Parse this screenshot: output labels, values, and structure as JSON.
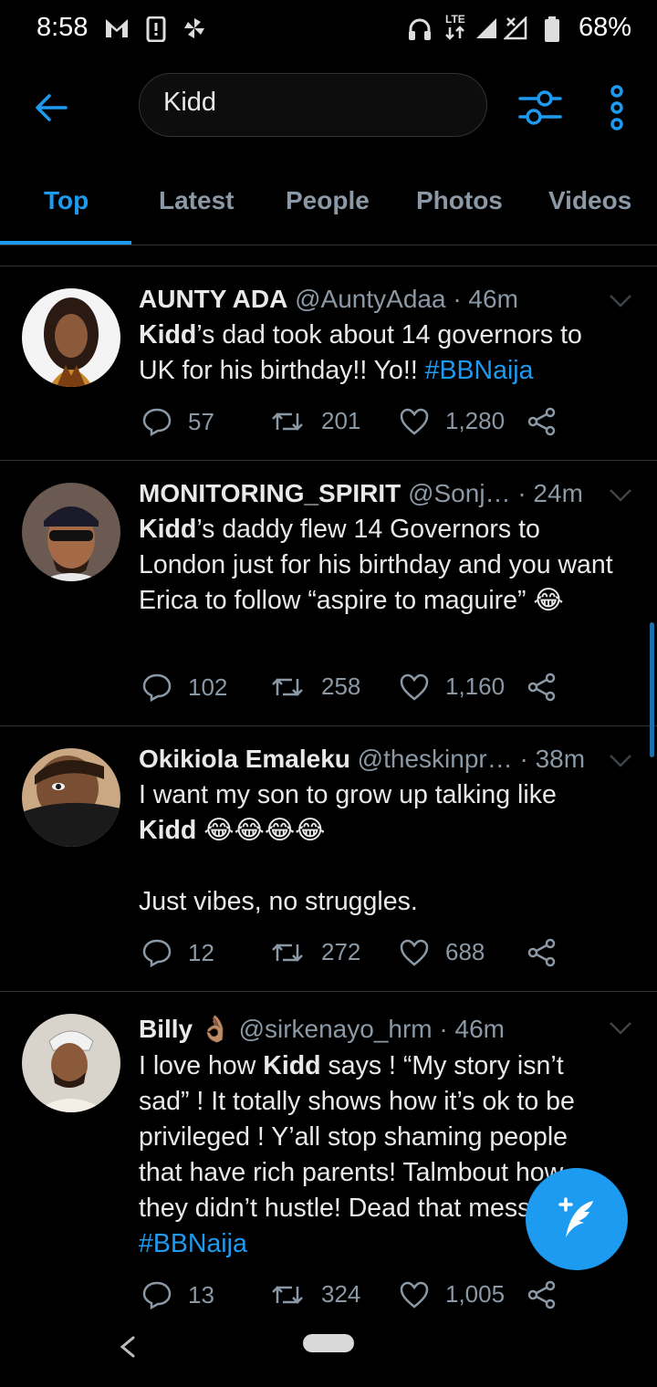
{
  "status_bar": {
    "time": "8:58",
    "network": "LTE",
    "battery": "68%"
  },
  "search": {
    "query": "Kidd"
  },
  "tabs": [
    {
      "label": "Top",
      "active": true
    },
    {
      "label": "Latest",
      "active": false
    },
    {
      "label": "People",
      "active": false
    },
    {
      "label": "Photos",
      "active": false
    },
    {
      "label": "Videos",
      "active": false
    }
  ],
  "tweets": [
    {
      "name": "AUNTY ADA",
      "handle": "@AuntyAdaa",
      "time": "· 46m",
      "text_parts": [
        {
          "b": "Kidd"
        },
        {
          "t": "’s dad took about 14 governors to UK  for his birthday!! Yo!! "
        },
        {
          "h": "#BBNaija"
        }
      ],
      "replies": "57",
      "retweets": "201",
      "likes": "1,280"
    },
    {
      "name": "MONITORING_SPIRIT",
      "handle": "@Sonj…",
      "time": "· 24m",
      "text_parts": [
        {
          "b": "Kidd"
        },
        {
          "t": "’s daddy flew 14 Governors to London just for his birthday and you want Erica to follow “aspire to maguire” 😂"
        }
      ],
      "replies": "102",
      "retweets": "258",
      "likes": "1,160"
    },
    {
      "name": "Okikiola Emaleku",
      "handle": "@theskinpr…",
      "time": "· 38m",
      "text_parts": [
        {
          "t": "I want my son to grow up talking like "
        },
        {
          "b": "Kidd"
        },
        {
          "t": " 😂😂😂😂\n\nJust vibes, no struggles."
        }
      ],
      "replies": "12",
      "retweets": "272",
      "likes": "688"
    },
    {
      "name": "Billy 👌🏽",
      "handle": "@sirkenayo_hrm",
      "time": "· 46m",
      "text_parts": [
        {
          "t": "I love how "
        },
        {
          "b": "Kidd"
        },
        {
          "t": " says ! “My story isn’t sad” ! It totally shows how it’s ok to be privileged ! Y’all stop shaming people that have rich parents! Talmbout how they didn’t hustle! Dead that mess! "
        },
        {
          "h": "#BBNaija"
        }
      ],
      "replies": "13",
      "retweets": "324",
      "likes": "1,005"
    }
  ],
  "icons": {
    "back": "arrow-left-icon",
    "filter": "sliders-icon",
    "more": "more-vertical-icon",
    "reply": "reply-icon",
    "retweet": "retweet-icon",
    "like": "heart-icon",
    "share": "share-icon",
    "compose": "compose-tweet-icon"
  },
  "colors": {
    "accent": "#1d9bf0",
    "background": "#000000",
    "text_secondary": "#8b98a5"
  }
}
